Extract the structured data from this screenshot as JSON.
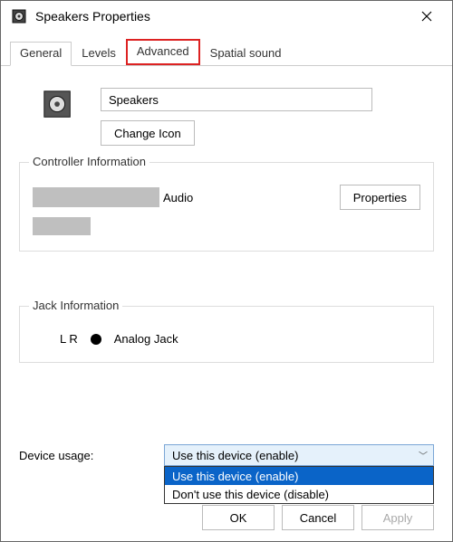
{
  "window": {
    "title": "Speakers Properties"
  },
  "tabs": {
    "general": "General",
    "levels": "Levels",
    "advanced": "Advanced",
    "spatial": "Spatial sound"
  },
  "device": {
    "name": "Speakers",
    "change_icon_label": "Change Icon"
  },
  "controller": {
    "legend": "Controller Information",
    "suffix": "Audio",
    "properties_label": "Properties"
  },
  "jack": {
    "legend": "Jack Information",
    "channels": "L R",
    "type": "Analog Jack"
  },
  "usage": {
    "label": "Device usage:",
    "selected": "Use this device (enable)",
    "options": [
      "Use this device (enable)",
      "Don't use this device (disable)"
    ]
  },
  "buttons": {
    "ok": "OK",
    "cancel": "Cancel",
    "apply": "Apply"
  }
}
